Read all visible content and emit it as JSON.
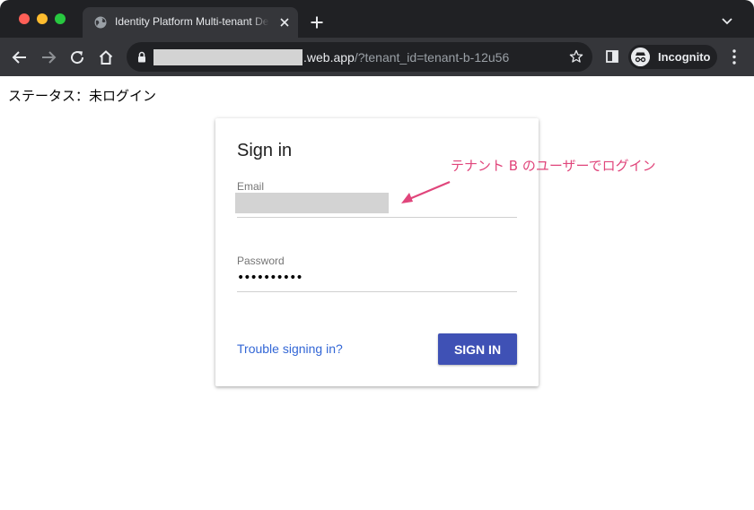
{
  "browser": {
    "tab_title": "Identity Platform Multi-tenant Demo",
    "url_host": ".web.app",
    "url_rest": "/?tenant_id=tenant-b-12u56",
    "incognito_label": "Incognito"
  },
  "page": {
    "status_text": "ステータス：未ログイン"
  },
  "signin": {
    "title": "Sign in",
    "email_label": "Email",
    "email_value": "",
    "password_label": "Password",
    "password_value": "••••••••••",
    "trouble_link": "Trouble signing in?",
    "submit_label": "SIGN IN"
  },
  "annotation": {
    "text": "テナント B のユーザーでログイン",
    "color": "#e0457b"
  },
  "colors": {
    "chrome_dark": "#202124",
    "chrome_tab": "#35363a",
    "primary_button": "#3f51b5",
    "link": "#3367d6"
  },
  "icons": [
    "globe-icon",
    "close-icon",
    "new-tab-icon",
    "tab-search-icon",
    "back-icon",
    "forward-icon",
    "reload-icon",
    "home-icon",
    "lock-icon",
    "star-icon",
    "side-panel-icon",
    "incognito-icon",
    "menu-icon",
    "annotation-arrow"
  ]
}
